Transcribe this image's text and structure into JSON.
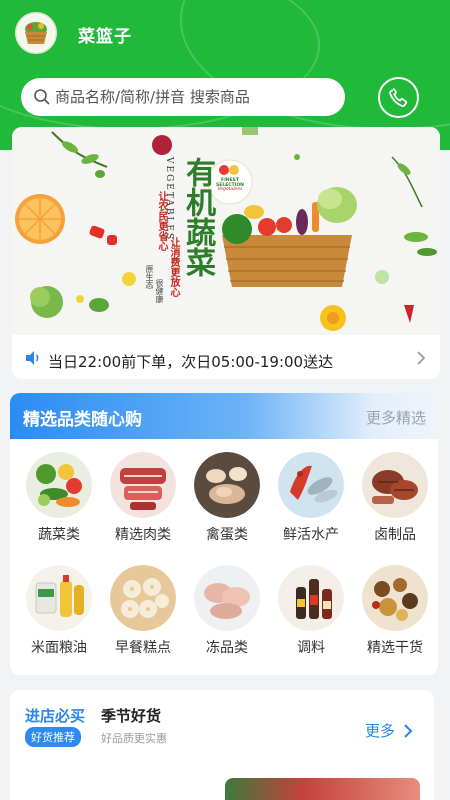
{
  "header": {
    "title": "菜篮子"
  },
  "search": {
    "placeholder": "商品名称/简称/拼音 搜索商品"
  },
  "banner": {
    "heading": "有机蔬菜",
    "english": "VEGETABLES",
    "slogan_left": "让农民更省心",
    "slogan_right": "让消费更放心",
    "col_a": "原生态",
    "col_b": "很健康",
    "badge_top": "FINEST SELECTION",
    "badge_bottom": "Vegetables"
  },
  "notice": {
    "text": "当日22:00前下单，次日05:00-19:00送达"
  },
  "categories": {
    "title": "精选品类随心购",
    "more": "更多精选",
    "items": [
      {
        "label": "蔬菜类",
        "icon": "vegetables-icon"
      },
      {
        "label": "精选肉类",
        "icon": "meat-icon"
      },
      {
        "label": "禽蛋类",
        "icon": "poultry-egg-icon"
      },
      {
        "label": "鲜活水产",
        "icon": "seafood-icon"
      },
      {
        "label": "卤制品",
        "icon": "braised-meat-icon"
      },
      {
        "label": "米面粮油",
        "icon": "rice-oil-icon"
      },
      {
        "label": "早餐糕点",
        "icon": "pastry-icon"
      },
      {
        "label": "冻品类",
        "icon": "frozen-icon"
      },
      {
        "label": "调料",
        "icon": "seasoning-icon"
      },
      {
        "label": "精选干货",
        "icon": "dried-goods-icon"
      }
    ]
  },
  "hot": {
    "title": "进店必买",
    "badge": "好货推荐",
    "season_title": "季节好货",
    "season_sub": "好品质更实惠",
    "more": "更多"
  },
  "colors": {
    "brand_green": "#20b93a",
    "accent_blue": "#2a86e8"
  }
}
